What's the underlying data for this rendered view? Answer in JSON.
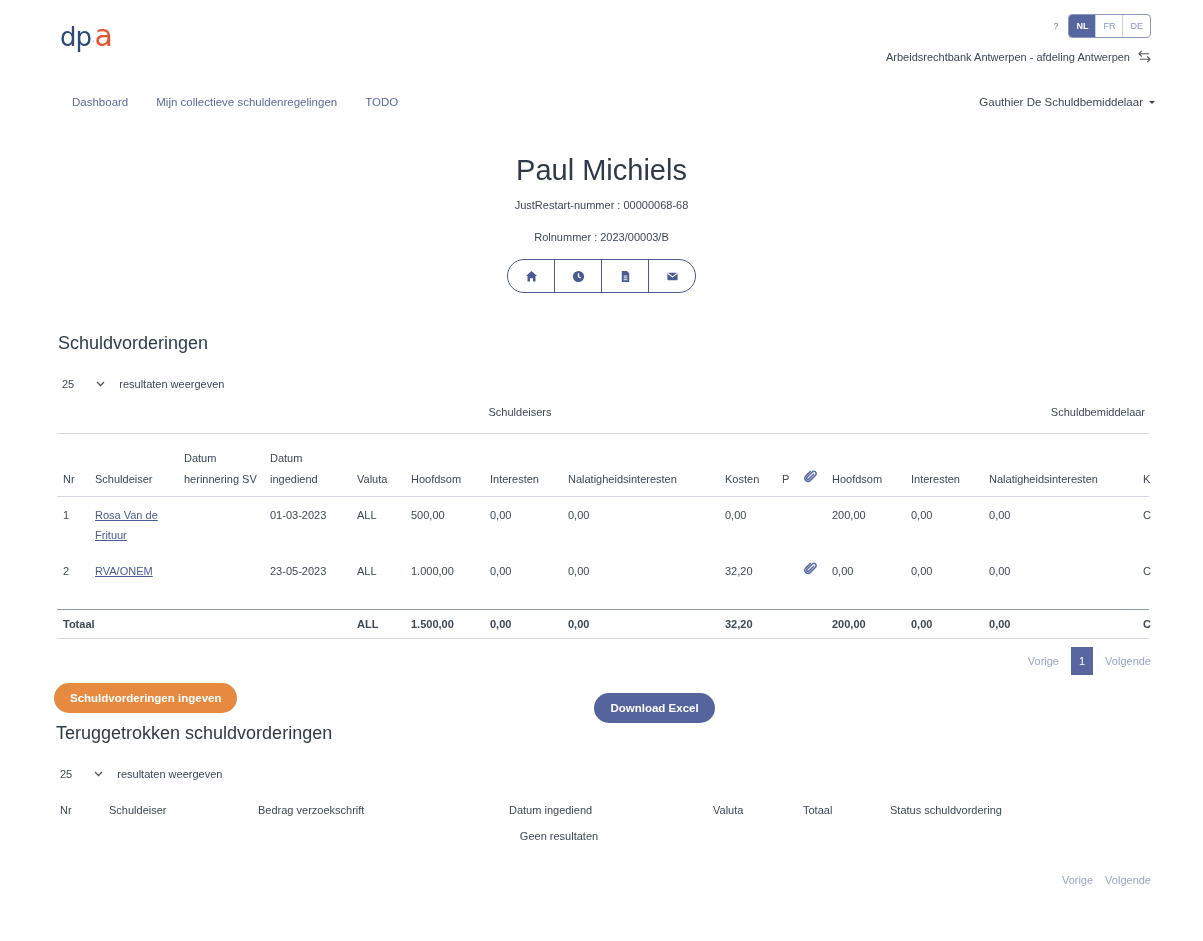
{
  "header": {
    "logo": [
      "dp",
      "·",
      "a"
    ],
    "help": "?",
    "languages": [
      {
        "label": "NL",
        "selected": true
      },
      {
        "label": "FR",
        "selected": false
      },
      {
        "label": "DE",
        "selected": false
      }
    ],
    "court": "Arbeidsrechtbank Antwerpen - afdeling Antwerpen"
  },
  "nav": {
    "items": [
      "Dashboard",
      "Mijn collectieve schuldenregelingen",
      "TODO"
    ],
    "user": "Gauthier De Schuldbemiddelaar"
  },
  "case": {
    "name": "Paul Michiels",
    "details": [
      "JustRestart-nummer : 00000068-68",
      "Rolnummer : 2023/00003/B"
    ],
    "actions": [
      {
        "kind": "home"
      },
      {
        "kind": "history"
      },
      {
        "kind": "document"
      },
      {
        "kind": "mail"
      }
    ]
  },
  "claims": {
    "title": "Schuldvorderingen",
    "page_length": "25",
    "page_length_label": "resultaten weergeven",
    "column_groups": [
      "Schuldeisers",
      "Schuldbemiddelaar"
    ],
    "columns": [
      {
        "label": "Nr"
      },
      {
        "label": "Schuldeiser"
      },
      {
        "label": "Datum herinnering SV"
      },
      {
        "label": "Datum ingediend"
      },
      {
        "label": "Valuta"
      },
      {
        "label": "Hoofdsom"
      },
      {
        "label": "Interesten"
      },
      {
        "label": "Nalatigheidsinteresten"
      },
      {
        "label": "Kosten"
      },
      {
        "label": "P"
      },
      {
        "kind": "attachment"
      },
      {
        "label": "Hoofdsom"
      },
      {
        "label": "Interesten"
      },
      {
        "label": "Nalatigheidsinteresten"
      },
      {
        "label": "K"
      }
    ],
    "rows": [
      {
        "nr": "1",
        "creditor": "Rosa Van de Frituur",
        "date_filed": "01-03-2023",
        "currency": "ALL",
        "principal": "500,00",
        "interest": "0,00",
        "late_interest": "0,00",
        "costs": "0,00",
        "attachment": false,
        "mediator_principal": "200,00",
        "mediator_interest": "0,00",
        "mediator_late_interest": "0,00",
        "column_15": "C"
      },
      {
        "nr": "2",
        "creditor": "RVA/ONEM",
        "date_filed": "23-05-2023",
        "currency": "ALL",
        "principal": "1.000,00",
        "interest": "0,00",
        "late_interest": "0,00",
        "costs": "32,20",
        "attachment": true,
        "mediator_principal": "0,00",
        "mediator_interest": "0,00",
        "mediator_late_interest": "0,00",
        "column_15": "C"
      }
    ],
    "totals": {
      "label": "Totaal",
      "currency": "ALL",
      "principal": "1.500,00",
      "interest": "0,00",
      "late_interest": "0,00",
      "costs": "32,20",
      "mediator_principal": "200,00",
      "mediator_interest": "0,00",
      "mediator_late_interest": "0,00",
      "column_15": "C"
    },
    "pagination": {
      "previous": "Vorige",
      "pages": [
        {
          "label": "1",
          "selected": true
        }
      ],
      "next": "Volgende"
    }
  },
  "buttons": [
    {
      "label": "Schuldvorderingen ingeven",
      "kind": "accent"
    },
    {
      "label": "Download Excel",
      "kind": "primary"
    }
  ],
  "withdrawn": {
    "title": "Teruggetrokken schuldvorderingen",
    "page_length": "25",
    "page_length_label": "resultaten weergeven",
    "columns": [
      "Nr",
      "Schuldeiser",
      "Bedrag verzoekschrift",
      "Datum ingediend",
      "Valuta",
      "Totaal",
      "Status schuldvordering"
    ],
    "empty": "Geen resultaten",
    "pagination": {
      "previous": "Vorige",
      "next": "Volgende"
    }
  }
}
